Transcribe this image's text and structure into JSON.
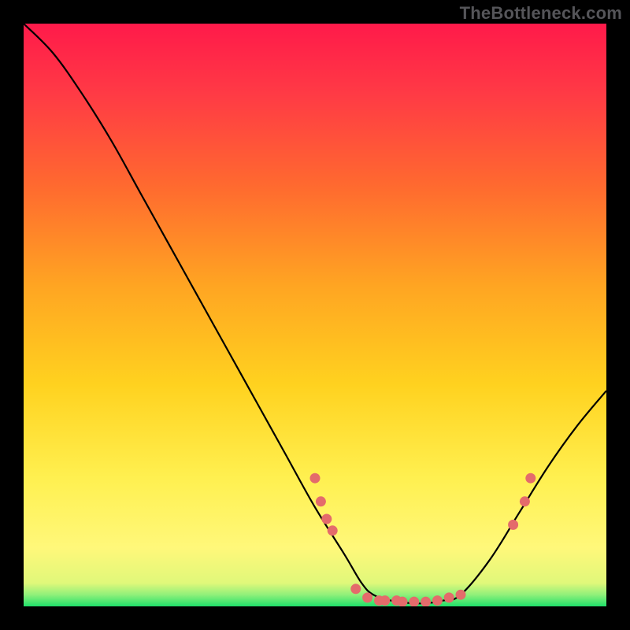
{
  "watermark": "TheBottleneck.com",
  "colors": {
    "background": "#000000",
    "gradient_top": "#ff1a4a",
    "gradient_mid1": "#ff6a2f",
    "gradient_mid2": "#ffd21f",
    "gradient_low": "#fff87a",
    "gradient_bottom": "#1fe06a",
    "curve": "#000000",
    "marker": "#e46b6b"
  },
  "chart_data": {
    "type": "line",
    "title": "",
    "xlabel": "",
    "ylabel": "",
    "ylim": [
      0,
      100
    ],
    "xlim": [
      0,
      100
    ],
    "curve": [
      {
        "x": 0,
        "y": 100
      },
      {
        "x": 5,
        "y": 95
      },
      {
        "x": 10,
        "y": 88
      },
      {
        "x": 15,
        "y": 80
      },
      {
        "x": 20,
        "y": 71
      },
      {
        "x": 25,
        "y": 62
      },
      {
        "x": 30,
        "y": 53
      },
      {
        "x": 35,
        "y": 44
      },
      {
        "x": 40,
        "y": 35
      },
      {
        "x": 45,
        "y": 26
      },
      {
        "x": 50,
        "y": 17
      },
      {
        "x": 55,
        "y": 9
      },
      {
        "x": 58,
        "y": 4
      },
      {
        "x": 60,
        "y": 2
      },
      {
        "x": 63,
        "y": 1
      },
      {
        "x": 68,
        "y": 0.5
      },
      {
        "x": 72,
        "y": 1
      },
      {
        "x": 75,
        "y": 2
      },
      {
        "x": 80,
        "y": 8
      },
      {
        "x": 85,
        "y": 16
      },
      {
        "x": 90,
        "y": 24
      },
      {
        "x": 95,
        "y": 31
      },
      {
        "x": 100,
        "y": 37
      }
    ],
    "markers": [
      {
        "x": 50,
        "y": 22
      },
      {
        "x": 51,
        "y": 18
      },
      {
        "x": 52,
        "y": 15
      },
      {
        "x": 53,
        "y": 13
      },
      {
        "x": 57,
        "y": 3
      },
      {
        "x": 59,
        "y": 1.5
      },
      {
        "x": 61,
        "y": 1
      },
      {
        "x": 62,
        "y": 1
      },
      {
        "x": 64,
        "y": 1
      },
      {
        "x": 65,
        "y": 0.8
      },
      {
        "x": 67,
        "y": 0.8
      },
      {
        "x": 69,
        "y": 0.8
      },
      {
        "x": 71,
        "y": 1
      },
      {
        "x": 73,
        "y": 1.5
      },
      {
        "x": 75,
        "y": 2
      },
      {
        "x": 84,
        "y": 14
      },
      {
        "x": 86,
        "y": 18
      },
      {
        "x": 87,
        "y": 22
      }
    ]
  }
}
